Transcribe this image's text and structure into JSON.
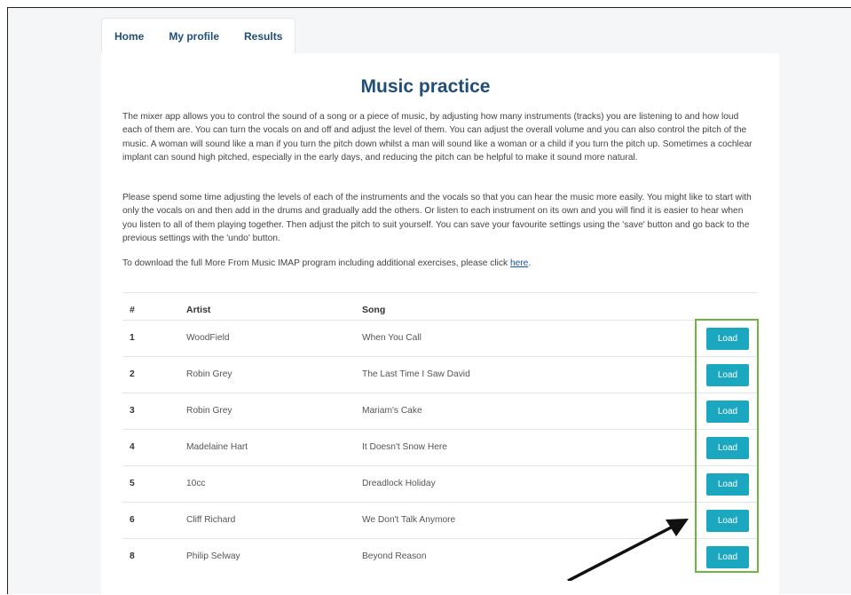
{
  "nav": {
    "tabs": [
      {
        "label": "Home"
      },
      {
        "label": "My profile"
      },
      {
        "label": "Results"
      }
    ]
  },
  "page": {
    "title": "Music practice",
    "paragraph1": "The mixer app allows you to control the sound of a song or a piece of music, by adjusting how many instruments (tracks) you are listening to and how loud each of them are. You can turn the vocals on and off and adjust the level of them. You can adjust the overall volume and you can also control the pitch of the music. A woman will sound like a man if you turn the pitch down whilst a man will sound like a woman or a child if you turn the pitch up. Sometimes a cochlear implant can sound high pitched, especially in the early days, and reducing the pitch can be helpful to make it sound more natural.",
    "paragraph2": "Please spend some time adjusting the levels of each of the instruments and the vocals so that you can hear the music more easily. You might like to start with only the vocals on and then add in the drums and gradually add the others. Or listen to each instrument on its own and you will find it is easier to hear when you listen to all of them playing together. Then adjust the pitch to suit yourself. You can save your favourite settings using the 'save' button and go back to the previous settings with the 'undo' button.",
    "download_text": "To download the full More From Music IMAP program including additional exercises, please click ",
    "download_link": "here",
    "download_end": "."
  },
  "table": {
    "headers": {
      "num": "#",
      "artist": "Artist",
      "song": "Song"
    },
    "load_label": "Load",
    "rows": [
      {
        "num": "1",
        "artist": "WoodField",
        "song": "When You Call"
      },
      {
        "num": "2",
        "artist": "Robin Grey",
        "song": "The Last Time I Saw David"
      },
      {
        "num": "3",
        "artist": "Robin Grey",
        "song": "Mariam's Cake"
      },
      {
        "num": "4",
        "artist": "Madelaine Hart",
        "song": "It Doesn't Snow Here"
      },
      {
        "num": "5",
        "artist": "10cc",
        "song": "Dreadlock Holiday"
      },
      {
        "num": "6",
        "artist": "Cliff Richard",
        "song": "We Don't Talk Anymore"
      },
      {
        "num": "8",
        "artist": "Philip Selway",
        "song": "Beyond Reason"
      }
    ]
  },
  "colors": {
    "accent": "#1ba7bf",
    "title": "#1f4e79",
    "highlight": "#6fb544"
  }
}
